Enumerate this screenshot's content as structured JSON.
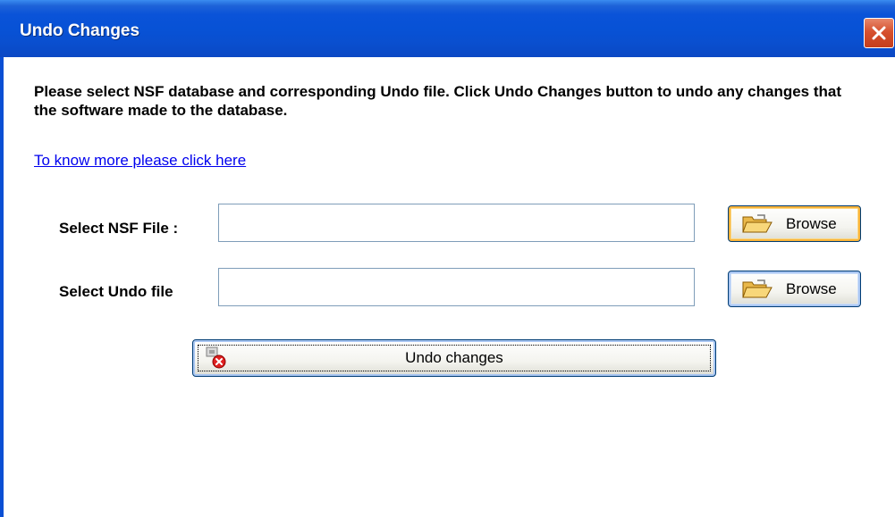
{
  "window": {
    "title": "Undo Changes",
    "close_icon": "close-icon"
  },
  "main": {
    "description": "Please select NSF database and corresponding Undo file. Click Undo Changes button to undo any changes that the software made to the database.",
    "more_link": "To know more please click here",
    "nsf": {
      "label": "Select NSF File :",
      "value": "",
      "browse_label": "Browse",
      "icon": "folder-open-icon"
    },
    "undo_file": {
      "label": "Select Undo file",
      "value": "",
      "browse_label": "Browse",
      "icon": "folder-open-icon"
    },
    "undo_button": {
      "label": "Undo changes",
      "icon": "undo-changes-icon"
    }
  },
  "colors": {
    "titlebar": "#0752d6",
    "close": "#d6512f",
    "link": "#0000ee",
    "button_border": "#003c74"
  }
}
